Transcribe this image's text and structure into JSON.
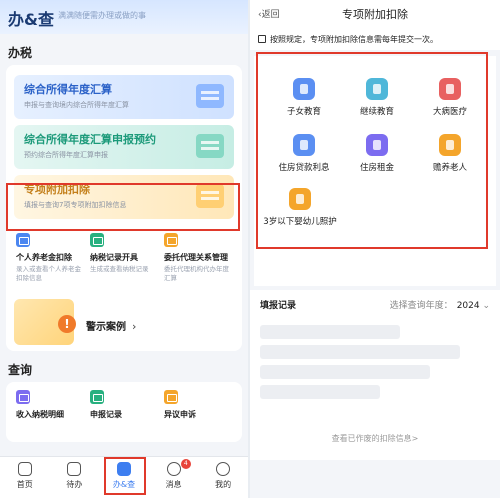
{
  "left": {
    "brand": "办&查",
    "brand_sub": "满满随便需办理或做的事",
    "section_tax": "办税",
    "banners": [
      {
        "title": "综合所得年度汇算",
        "subtitle": "申报与查询境内综合所得年度汇算"
      },
      {
        "title": "综合所得年度汇算申报预约",
        "subtitle": "预约综合所得年度汇算申报"
      },
      {
        "title": "专项附加扣除",
        "subtitle": "填报与查询7项专项附加扣除信息"
      }
    ],
    "grid": [
      {
        "title": "个人养老金扣除",
        "subtitle": "录入或查看个人养老金扣除信息"
      },
      {
        "title": "纳税记录开具",
        "subtitle": "生成或查看纳税记录"
      },
      {
        "title": "委托代理关系管理",
        "subtitle": "委托代理机构代办年度汇算"
      }
    ],
    "case_label": "警示案例",
    "section_query": "查询",
    "query_items": [
      "收入纳税明细",
      "申报记录",
      "异议申诉"
    ],
    "tabs": [
      {
        "label": "首页"
      },
      {
        "label": "待办"
      },
      {
        "label": "办&查"
      },
      {
        "label": "消息",
        "badge": "4"
      },
      {
        "label": "我的"
      }
    ]
  },
  "right": {
    "back_label": "返回",
    "title": "专项附加扣除",
    "notice": "按照规定，专项附加扣除信息需每年提交一次。",
    "items": [
      {
        "label": "子女教育",
        "icon": "child-education-icon",
        "color": "c-blue"
      },
      {
        "label": "继续教育",
        "icon": "graduation-cap-icon",
        "color": "c-teal"
      },
      {
        "label": "大病医疗",
        "icon": "medical-kit-icon",
        "color": "c-red"
      },
      {
        "label": "住房贷款利息",
        "icon": "house-loan-icon",
        "color": "c-blue"
      },
      {
        "label": "住房租金",
        "icon": "house-rent-icon",
        "color": "c-purple"
      },
      {
        "label": "赡养老人",
        "icon": "elder-care-icon",
        "color": "c-orange"
      },
      {
        "label": "3岁以下婴幼儿照护",
        "icon": "infant-care-icon",
        "color": "c-orange"
      }
    ],
    "record_title": "填报记录",
    "year_label": "选择查询年度：",
    "year_value": "2024",
    "view_link": "查看已作废的扣除信息>"
  },
  "colors": {
    "accent": "#3d7ef0",
    "highlight": "#e0392b"
  }
}
